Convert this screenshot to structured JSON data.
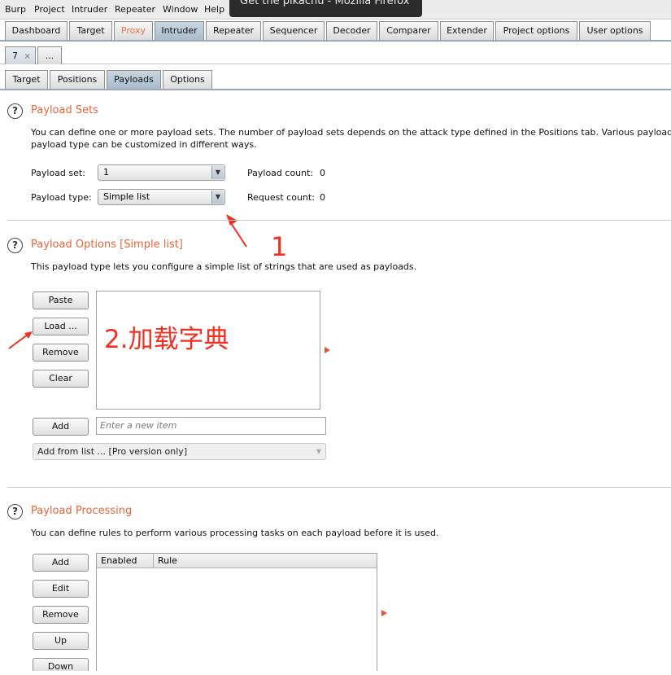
{
  "menubar": {
    "items": [
      "Burp",
      "Project",
      "Intruder",
      "Repeater",
      "Window",
      "Help"
    ]
  },
  "window_tooltip": "Get the pikachu - Mozilla Firefox",
  "main_tabs": [
    "Dashboard",
    "Target",
    "Proxy",
    "Intruder",
    "Repeater",
    "Sequencer",
    "Decoder",
    "Comparer",
    "Extender",
    "Project options",
    "User options"
  ],
  "attack_tabs": {
    "current": "7",
    "close_glyph": "×",
    "more": "..."
  },
  "sub_tabs": [
    "Target",
    "Positions",
    "Payloads",
    "Options"
  ],
  "payload_sets": {
    "title": "Payload Sets",
    "description_line1": "You can define one or more payload sets. The number of payload sets depends on the attack type defined in the Positions tab. Various payload",
    "description_line2": "payload type can be customized in different ways.",
    "set_label": "Payload set:",
    "set_value": "1",
    "type_label": "Payload type:",
    "type_value": "Simple list",
    "payload_count_label": "Payload count:",
    "payload_count": "0",
    "request_count_label": "Request count:",
    "request_count": "0"
  },
  "payload_options": {
    "title": "Payload Options [Simple list]",
    "description": "This payload type lets you configure a simple list of strings that are used as payloads.",
    "buttons": {
      "paste": "Paste",
      "load": "Load ...",
      "remove": "Remove",
      "clear": "Clear",
      "add": "Add"
    },
    "new_item_placeholder": "Enter a new item",
    "add_from_list": "Add from list ... [Pro version only]"
  },
  "payload_processing": {
    "title": "Payload Processing",
    "description": "You can define rules to perform various processing tasks on each payload before it is used.",
    "buttons": {
      "add": "Add",
      "edit": "Edit",
      "remove": "Remove",
      "up": "Up",
      "down": "Down"
    },
    "columns": [
      "Enabled",
      "Rule"
    ]
  },
  "annotations": {
    "step1": "1",
    "step2": "2.加载字典"
  },
  "colors": {
    "section_title": "#e8653a",
    "annotation": "#f03020",
    "active_tab": "#a9bccd"
  }
}
